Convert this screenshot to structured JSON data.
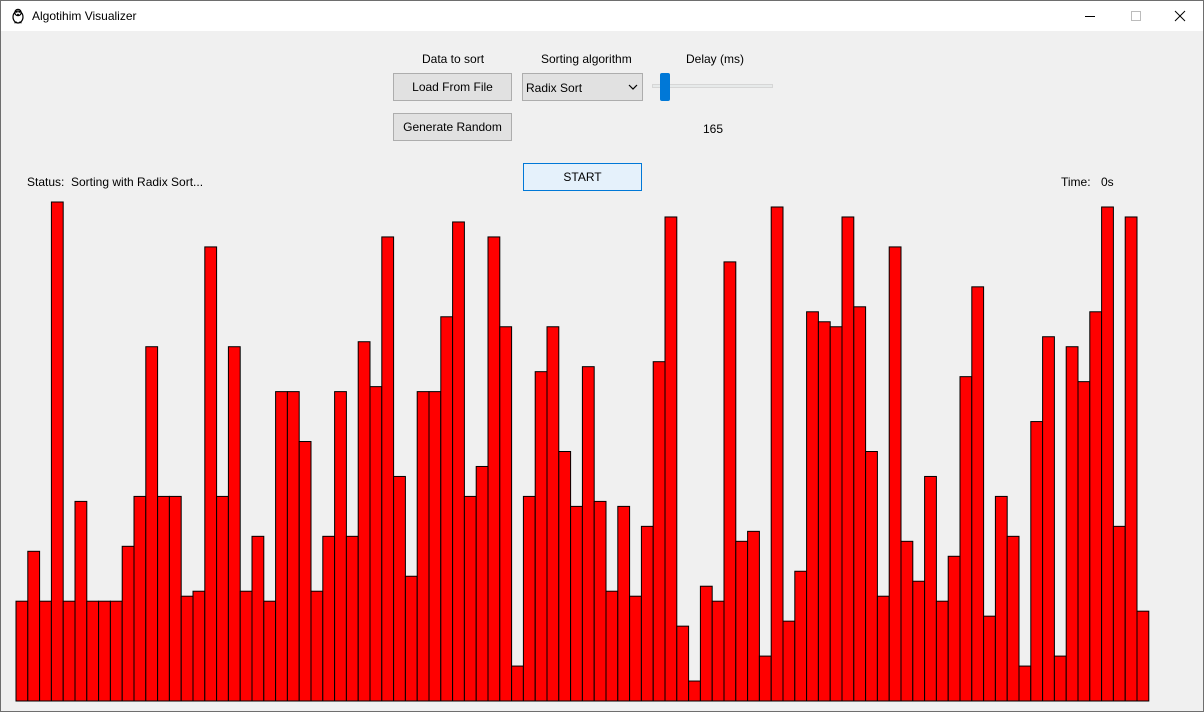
{
  "window": {
    "title": "Algotihim Visualizer",
    "app_icon": "penguin-icon",
    "controls": [
      "minimize-icon",
      "maximize-icon",
      "close-icon"
    ]
  },
  "controls": {
    "data_label": "Data to sort",
    "load_button": "Load From File",
    "random_button": "Generate Random",
    "algorithm_label": "Sorting algorithm",
    "algorithm_selected": "Radix Sort",
    "delay_label": "Delay (ms)",
    "delay_value": "165",
    "start_button": "START"
  },
  "status": {
    "label": "Status:",
    "text": "Sorting with Radix Sort...",
    "time_label": "Time:",
    "time_value": "0s"
  },
  "colors": {
    "bar_fill": "#ff0000",
    "bar_stroke": "#000000",
    "accent": "#0078d7"
  },
  "chart_data": {
    "type": "bar",
    "values": [
      100,
      150,
      100,
      500,
      100,
      200,
      100,
      100,
      100,
      155,
      205,
      355,
      205,
      205,
      105,
      110,
      455,
      205,
      355,
      110,
      165,
      100,
      310,
      310,
      260,
      110,
      165,
      310,
      165,
      360,
      315,
      465,
      225,
      125,
      310,
      310,
      385,
      480,
      205,
      235,
      465,
      375,
      35,
      205,
      330,
      375,
      250,
      195,
      335,
      200,
      110,
      195,
      105,
      175,
      340,
      485,
      75,
      20,
      115,
      100,
      440,
      160,
      170,
      45,
      495,
      80,
      130,
      390,
      380,
      375,
      485,
      395,
      250,
      105,
      455,
      160,
      120,
      225,
      100,
      145,
      325,
      415,
      85,
      205,
      165,
      35,
      280,
      365,
      45,
      355,
      320,
      390,
      495,
      175,
      485,
      90
    ],
    "ylim": [
      0,
      500
    ]
  }
}
